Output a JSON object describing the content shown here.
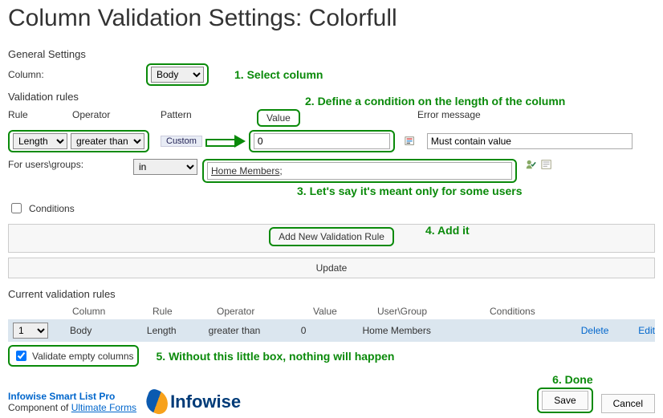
{
  "page_title": "Column Validation Settings: Colorfull",
  "general": {
    "heading": "General Settings",
    "column_label": "Column:",
    "column_value": "Body"
  },
  "validation": {
    "heading": "Validation rules",
    "cols": {
      "rule": "Rule",
      "operator": "Operator",
      "pattern": "Pattern",
      "value": "Value",
      "error": "Error message"
    },
    "rule_value": "Length",
    "operator_value": "greater than",
    "pattern_value": "Custom",
    "value_value": "0",
    "error_value": "Must contain value",
    "users_label": "For users\\groups:",
    "users_scope": "in",
    "users_value": "Home Members",
    "conditions_label": "Conditions",
    "add_btn": "Add New Validation Rule",
    "update_btn": "Update"
  },
  "current": {
    "heading": "Current validation rules",
    "cols": {
      "column": "Column",
      "rule": "Rule",
      "operator": "Operator",
      "value": "Value",
      "usergroup": "User\\Group",
      "conditions": "Conditions"
    },
    "order_value": "1",
    "row": {
      "column": "Body",
      "rule": "Length",
      "operator": "greater than",
      "value": "0",
      "usergroup": "Home Members"
    },
    "delete": "Delete",
    "edit": "Edit",
    "validate_empty_label": "Validate empty columns"
  },
  "footer": {
    "product": "Infowise Smart List Pro",
    "component_prefix": "Component of ",
    "component_link": "Ultimate Forms",
    "logo_text": "Infowise",
    "save": "Save",
    "cancel": "Cancel"
  },
  "annotations": {
    "a1": "1. Select column",
    "a2": "2. Define a condition on the length of the column",
    "a3": "3. Let's say it's meant only for some users",
    "a4": "4. Add it",
    "a5": "5. Without this little box, nothing will happen",
    "a6": "6. Done"
  }
}
